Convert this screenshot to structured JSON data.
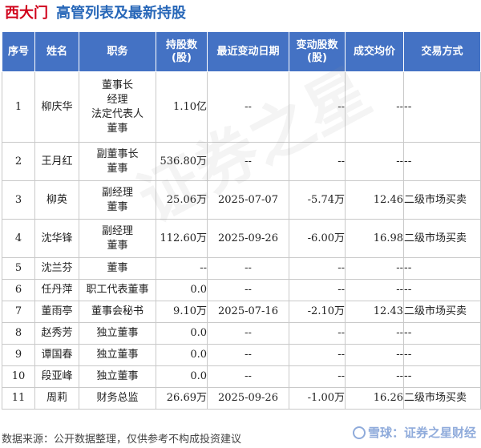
{
  "title": {
    "company": "西大门",
    "heading": "高管列表及最新持股"
  },
  "columns": [
    "序号",
    "姓名",
    "职务",
    "持股数\n(股)",
    "最近变动日期",
    "变动股数\n(股)",
    "成交均价",
    "交易方式"
  ],
  "rows": [
    {
      "no": "1",
      "name": "柳庆华",
      "roles": [
        "董事长",
        "经理",
        "法定代表人",
        "董事"
      ],
      "shares": "1.10亿",
      "date": "--",
      "change": "--",
      "price": "--",
      "method": "--"
    },
    {
      "no": "2",
      "name": "王月红",
      "roles": [
        "副董事长",
        "董事"
      ],
      "shares": "536.80万",
      "date": "--",
      "change": "--",
      "price": "--",
      "method": "--"
    },
    {
      "no": "3",
      "name": "柳英",
      "roles": [
        "副经理",
        "董事"
      ],
      "shares": "25.06万",
      "date": "2025-07-07",
      "change": "-5.74万",
      "price": "12.46",
      "method": "二级市场买卖"
    },
    {
      "no": "4",
      "name": "沈华锋",
      "roles": [
        "副经理",
        "董事"
      ],
      "shares": "112.60万",
      "date": "2025-09-26",
      "change": "-6.00万",
      "price": "16.98",
      "method": "二级市场买卖"
    },
    {
      "no": "5",
      "name": "沈兰芬",
      "roles": [
        "董事"
      ],
      "shares": "--",
      "date": "--",
      "change": "--",
      "price": "--",
      "method": "--"
    },
    {
      "no": "6",
      "name": "任丹萍",
      "roles": [
        "职工代表董事"
      ],
      "shares": "0.0",
      "date": "--",
      "change": "--",
      "price": "--",
      "method": "--"
    },
    {
      "no": "7",
      "name": "董雨亭",
      "roles": [
        "董事会秘书"
      ],
      "shares": "9.10万",
      "date": "2025-07-16",
      "change": "-2.10万",
      "price": "12.43",
      "method": "二级市场买卖"
    },
    {
      "no": "8",
      "name": "赵秀芳",
      "roles": [
        "独立董事"
      ],
      "shares": "0.0",
      "date": "--",
      "change": "--",
      "price": "--",
      "method": "--"
    },
    {
      "no": "9",
      "name": "谭国春",
      "roles": [
        "独立董事"
      ],
      "shares": "0.0",
      "date": "--",
      "change": "--",
      "price": "--",
      "method": "--"
    },
    {
      "no": "10",
      "name": "段亚峰",
      "roles": [
        "独立董事"
      ],
      "shares": "0.0",
      "date": "--",
      "change": "--",
      "price": "--",
      "method": "--"
    },
    {
      "no": "11",
      "name": "周莉",
      "roles": [
        "财务总监"
      ],
      "shares": "26.69万",
      "date": "2025-09-26",
      "change": "-1.00万",
      "price": "16.26",
      "method": "二级市场买卖"
    }
  ],
  "footer": "数据来源：公开数据整理，仅供参考不构成投资建议",
  "brand": "雪球：证券之星财经",
  "watermark": "证券之星",
  "colors": {
    "header_bg": "#4472c4",
    "company": "#d0021b",
    "heading": "#2767b8",
    "change_text": "#1a8a2e"
  }
}
